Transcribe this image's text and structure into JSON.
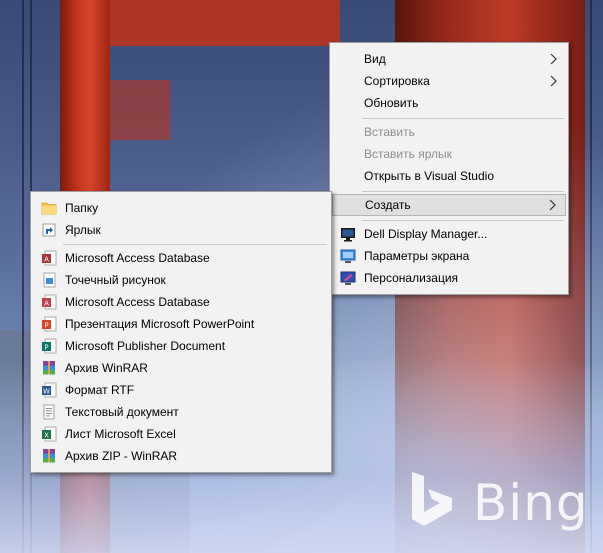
{
  "wallpaper": {
    "brand_text": "Bing",
    "colors": {
      "sky_top": "#3a4a78",
      "tower": "#c4341e",
      "haze": "#c9d4ea"
    }
  },
  "main_menu": {
    "items": [
      {
        "label": "Вид",
        "submenu": true,
        "enabled": true
      },
      {
        "label": "Сортировка",
        "submenu": true,
        "enabled": true
      },
      {
        "label": "Обновить",
        "submenu": false,
        "enabled": true
      },
      {
        "label": "Вставить",
        "submenu": false,
        "enabled": false
      },
      {
        "label": "Вставить ярлык",
        "submenu": false,
        "enabled": false
      },
      {
        "label": "Открыть в Visual Studio",
        "submenu": false,
        "enabled": true
      },
      {
        "label": "Создать",
        "submenu": true,
        "enabled": true,
        "highlighted": true
      },
      {
        "label": "Dell Display Manager...",
        "icon": "monitor-icon",
        "enabled": true
      },
      {
        "label": "Параметры экрана",
        "icon": "display-settings-icon",
        "enabled": true
      },
      {
        "label": "Персонализация",
        "icon": "personalize-icon",
        "enabled": true
      }
    ]
  },
  "create_submenu": {
    "items": [
      {
        "label": "Папку",
        "icon": "folder-icon"
      },
      {
        "label": "Ярлык",
        "icon": "shortcut-icon"
      },
      {
        "label": "Microsoft Access Database",
        "icon": "access-icon"
      },
      {
        "label": "Точечный рисунок",
        "icon": "bitmap-icon"
      },
      {
        "label": "Microsoft Access Database",
        "icon": "access-icon"
      },
      {
        "label": "Презентация Microsoft PowerPoint",
        "icon": "powerpoint-icon"
      },
      {
        "label": "Microsoft Publisher Document",
        "icon": "publisher-icon"
      },
      {
        "label": "Архив WinRAR",
        "icon": "winrar-icon"
      },
      {
        "label": "Формат RTF",
        "icon": "rtf-icon"
      },
      {
        "label": "Текстовый документ",
        "icon": "text-document-icon"
      },
      {
        "label": "Лист Microsoft Excel",
        "icon": "excel-icon"
      },
      {
        "label": "Архив ZIP - WinRAR",
        "icon": "winrar-zip-icon"
      }
    ]
  },
  "colors": {
    "menu_bg": "#f2f2f2",
    "menu_border": "#a0a0a0",
    "highlight_bg": "#e0e0e0",
    "disabled_text": "#8e8e8e"
  }
}
